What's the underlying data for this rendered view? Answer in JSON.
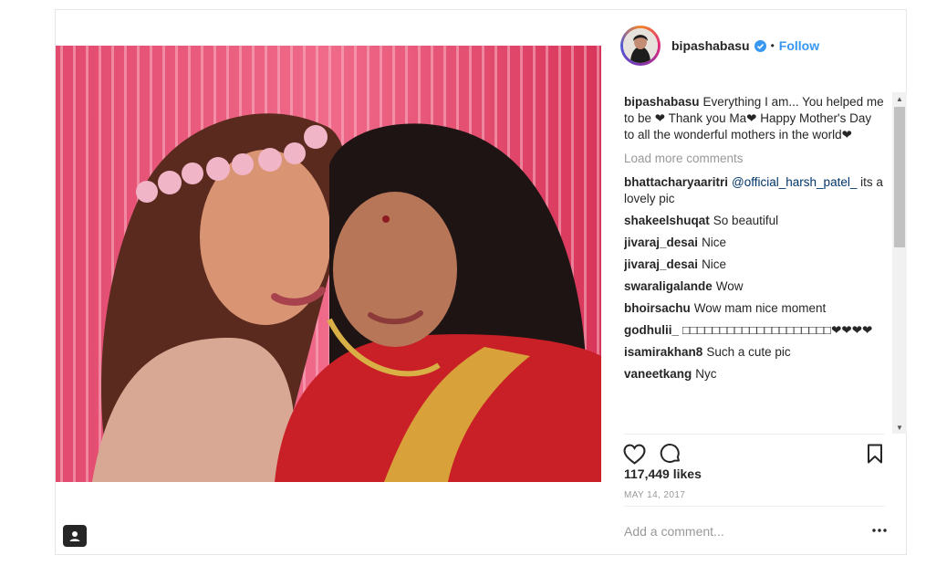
{
  "header": {
    "username": "bipashabasu",
    "separator": "•",
    "follow_label": "Follow"
  },
  "caption": {
    "username": "bipashabasu",
    "text": "Everything I am... You helped me to be ❤ Thank you Ma❤ Happy Mother's Day to all the wonderful mothers in the world❤"
  },
  "load_more_label": "Load more comments",
  "comments": [
    {
      "user": "bhattacharyaaritri",
      "mention": "@official_harsh_patel_",
      "text": "its a lovely pic"
    },
    {
      "user": "shakeelshuqat",
      "mention": "",
      "text": "So beautiful"
    },
    {
      "user": "jivaraj_desai",
      "mention": "",
      "text": "Nice"
    },
    {
      "user": "jivaraj_desai",
      "mention": "",
      "text": "Nice"
    },
    {
      "user": "swaraligalande",
      "mention": "",
      "text": "Wow"
    },
    {
      "user": "bhoirsachu",
      "mention": "",
      "text": "Wow mam nice moment"
    },
    {
      "user": "godhulii_",
      "mention": "",
      "text": "□□□□□□□□□□□□□□□□□□□□❤❤❤❤"
    },
    {
      "user": "isamirakhan8",
      "mention": "",
      "text": "Such a cute pic"
    },
    {
      "user": "vaneetkang",
      "mention": "",
      "text": "Nyc"
    }
  ],
  "likes_label": "117,449 likes",
  "date_label": "MAY 14, 2017",
  "add_comment_placeholder": "Add a comment...",
  "colors": {
    "link": "#3897f0",
    "muted": "#999999",
    "text": "#262626",
    "verified": "#3897f0"
  },
  "icons": {
    "like": "heart-icon",
    "comment": "speech-bubble-icon",
    "save": "bookmark-icon",
    "more": "ellipsis-icon",
    "tag": "user-tag-icon",
    "verified": "verified-badge-icon"
  }
}
